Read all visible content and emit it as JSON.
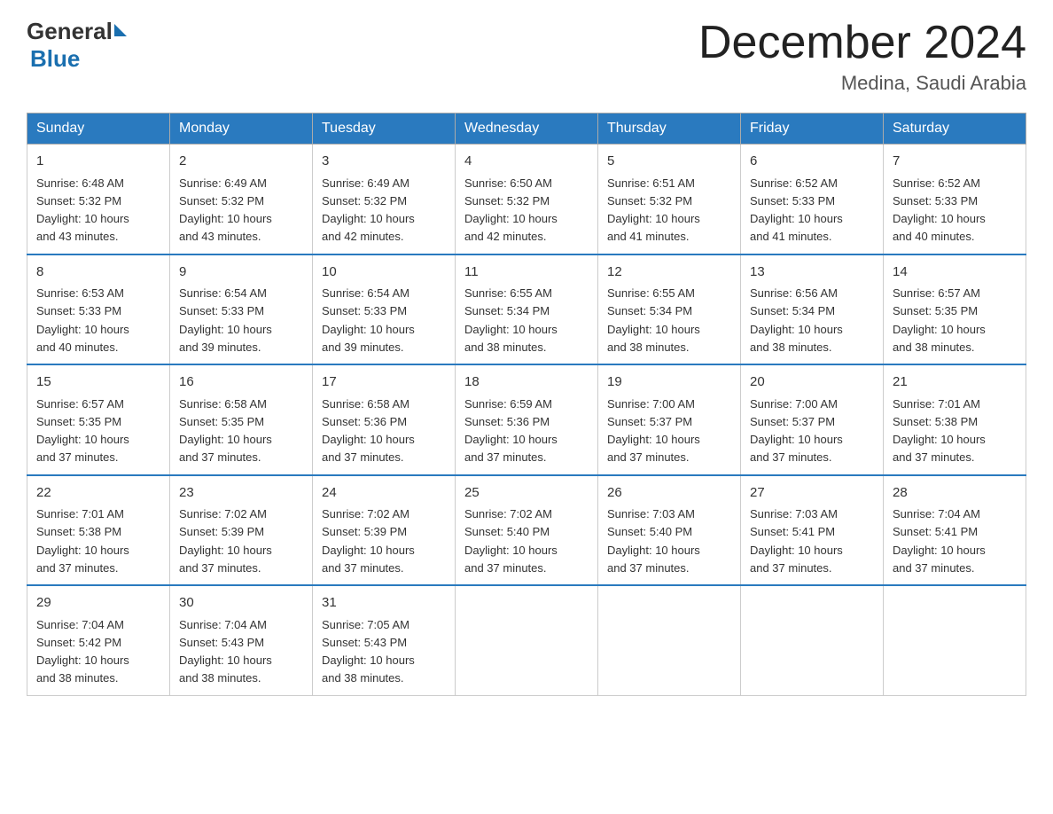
{
  "logo": {
    "general": "General",
    "blue": "Blue"
  },
  "header": {
    "title": "December 2024",
    "subtitle": "Medina, Saudi Arabia"
  },
  "weekdays": [
    "Sunday",
    "Monday",
    "Tuesday",
    "Wednesday",
    "Thursday",
    "Friday",
    "Saturday"
  ],
  "weeks": [
    [
      {
        "day": "1",
        "sunrise": "6:48 AM",
        "sunset": "5:32 PM",
        "daylight": "10 hours and 43 minutes."
      },
      {
        "day": "2",
        "sunrise": "6:49 AM",
        "sunset": "5:32 PM",
        "daylight": "10 hours and 43 minutes."
      },
      {
        "day": "3",
        "sunrise": "6:49 AM",
        "sunset": "5:32 PM",
        "daylight": "10 hours and 42 minutes."
      },
      {
        "day": "4",
        "sunrise": "6:50 AM",
        "sunset": "5:32 PM",
        "daylight": "10 hours and 42 minutes."
      },
      {
        "day": "5",
        "sunrise": "6:51 AM",
        "sunset": "5:32 PM",
        "daylight": "10 hours and 41 minutes."
      },
      {
        "day": "6",
        "sunrise": "6:52 AM",
        "sunset": "5:33 PM",
        "daylight": "10 hours and 41 minutes."
      },
      {
        "day": "7",
        "sunrise": "6:52 AM",
        "sunset": "5:33 PM",
        "daylight": "10 hours and 40 minutes."
      }
    ],
    [
      {
        "day": "8",
        "sunrise": "6:53 AM",
        "sunset": "5:33 PM",
        "daylight": "10 hours and 40 minutes."
      },
      {
        "day": "9",
        "sunrise": "6:54 AM",
        "sunset": "5:33 PM",
        "daylight": "10 hours and 39 minutes."
      },
      {
        "day": "10",
        "sunrise": "6:54 AM",
        "sunset": "5:33 PM",
        "daylight": "10 hours and 39 minutes."
      },
      {
        "day": "11",
        "sunrise": "6:55 AM",
        "sunset": "5:34 PM",
        "daylight": "10 hours and 38 minutes."
      },
      {
        "day": "12",
        "sunrise": "6:55 AM",
        "sunset": "5:34 PM",
        "daylight": "10 hours and 38 minutes."
      },
      {
        "day": "13",
        "sunrise": "6:56 AM",
        "sunset": "5:34 PM",
        "daylight": "10 hours and 38 minutes."
      },
      {
        "day": "14",
        "sunrise": "6:57 AM",
        "sunset": "5:35 PM",
        "daylight": "10 hours and 38 minutes."
      }
    ],
    [
      {
        "day": "15",
        "sunrise": "6:57 AM",
        "sunset": "5:35 PM",
        "daylight": "10 hours and 37 minutes."
      },
      {
        "day": "16",
        "sunrise": "6:58 AM",
        "sunset": "5:35 PM",
        "daylight": "10 hours and 37 minutes."
      },
      {
        "day": "17",
        "sunrise": "6:58 AM",
        "sunset": "5:36 PM",
        "daylight": "10 hours and 37 minutes."
      },
      {
        "day": "18",
        "sunrise": "6:59 AM",
        "sunset": "5:36 PM",
        "daylight": "10 hours and 37 minutes."
      },
      {
        "day": "19",
        "sunrise": "7:00 AM",
        "sunset": "5:37 PM",
        "daylight": "10 hours and 37 minutes."
      },
      {
        "day": "20",
        "sunrise": "7:00 AM",
        "sunset": "5:37 PM",
        "daylight": "10 hours and 37 minutes."
      },
      {
        "day": "21",
        "sunrise": "7:01 AM",
        "sunset": "5:38 PM",
        "daylight": "10 hours and 37 minutes."
      }
    ],
    [
      {
        "day": "22",
        "sunrise": "7:01 AM",
        "sunset": "5:38 PM",
        "daylight": "10 hours and 37 minutes."
      },
      {
        "day": "23",
        "sunrise": "7:02 AM",
        "sunset": "5:39 PM",
        "daylight": "10 hours and 37 minutes."
      },
      {
        "day": "24",
        "sunrise": "7:02 AM",
        "sunset": "5:39 PM",
        "daylight": "10 hours and 37 minutes."
      },
      {
        "day": "25",
        "sunrise": "7:02 AM",
        "sunset": "5:40 PM",
        "daylight": "10 hours and 37 minutes."
      },
      {
        "day": "26",
        "sunrise": "7:03 AM",
        "sunset": "5:40 PM",
        "daylight": "10 hours and 37 minutes."
      },
      {
        "day": "27",
        "sunrise": "7:03 AM",
        "sunset": "5:41 PM",
        "daylight": "10 hours and 37 minutes."
      },
      {
        "day": "28",
        "sunrise": "7:04 AM",
        "sunset": "5:41 PM",
        "daylight": "10 hours and 37 minutes."
      }
    ],
    [
      {
        "day": "29",
        "sunrise": "7:04 AM",
        "sunset": "5:42 PM",
        "daylight": "10 hours and 38 minutes."
      },
      {
        "day": "30",
        "sunrise": "7:04 AM",
        "sunset": "5:43 PM",
        "daylight": "10 hours and 38 minutes."
      },
      {
        "day": "31",
        "sunrise": "7:05 AM",
        "sunset": "5:43 PM",
        "daylight": "10 hours and 38 minutes."
      },
      null,
      null,
      null,
      null
    ]
  ],
  "labels": {
    "sunrise": "Sunrise:",
    "sunset": "Sunset:",
    "daylight": "Daylight:"
  }
}
